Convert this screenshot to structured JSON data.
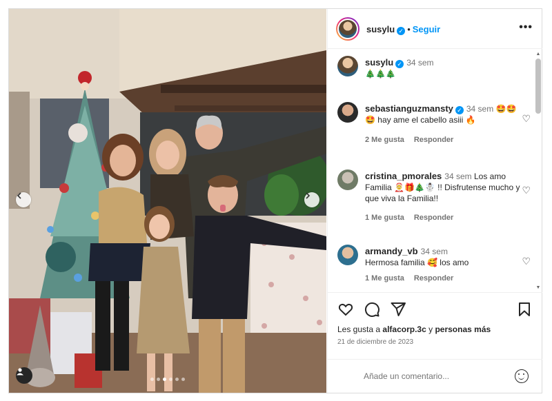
{
  "post": {
    "username": "susylu",
    "follow_label": "Seguir",
    "separator": "•",
    "caption_time": "34 sem",
    "caption_text": "🎄🎄🎄"
  },
  "comments": [
    {
      "username": "sebastianguzmansty",
      "verified": true,
      "time": "34 sem",
      "text": "🤩🤩🤩 hay ame el cabello asiii 🔥",
      "likes": "2 Me gusta",
      "reply": "Responder"
    },
    {
      "username": "cristina_pmorales",
      "verified": false,
      "time": "34 sem",
      "text": "Los amo Familia 🤶🎁🎄☃️ !! Disfrutense mucho y que viva la Familia!!",
      "likes": "1 Me gusta",
      "reply": "Responder"
    },
    {
      "username": "armandy_vb",
      "verified": false,
      "time": "34 sem",
      "text": "Hermosa familia 🥰 los amo",
      "likes": "1 Me gusta",
      "reply": "Responder"
    }
  ],
  "actions": {
    "likes_prefix": "Les gusta a",
    "likes_user": "alfacorp.3c",
    "likes_suffix": "y",
    "likes_others": "personas más",
    "date": "21 de diciembre de 2023",
    "comment_placeholder": "Añade un comentario..."
  },
  "carousel": {
    "count": 6,
    "active_index": 2
  },
  "icons": [
    "chevron-left-icon",
    "chevron-right-icon",
    "user-tag-icon",
    "verified-icon",
    "more-icon",
    "heart-icon",
    "comment-icon",
    "share-icon",
    "bookmark-icon",
    "emoji-icon"
  ],
  "colors": {
    "link": "#0095f6",
    "text": "#262626",
    "muted": "#737373"
  }
}
